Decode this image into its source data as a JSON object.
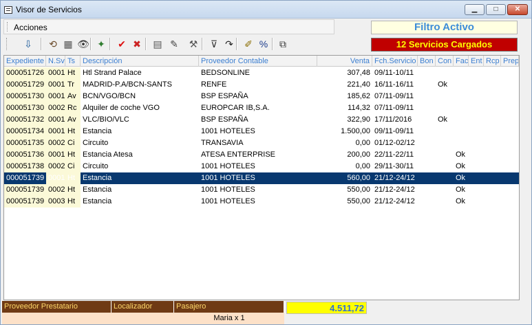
{
  "window": {
    "title": "Visor de Servicios"
  },
  "menu": {
    "items": [
      {
        "label": "Acciones"
      }
    ]
  },
  "status": {
    "filter": "Filtro Activo",
    "count": "12 Servicios Cargados"
  },
  "toolbar": {
    "buttons": [
      {
        "icon": "import-icon",
        "glyph": "⇩"
      },
      {
        "icon": "refresh-icon",
        "glyph": "⟲"
      },
      {
        "icon": "select-all-icon",
        "glyph": "▦"
      },
      {
        "icon": "view-eye-icon",
        "glyph": "👁"
      },
      {
        "icon": "rs-validate-icon",
        "glyph": "✦"
      },
      {
        "icon": "check-icon",
        "glyph": "✔"
      },
      {
        "icon": "delete-x-icon",
        "glyph": "✖"
      },
      {
        "icon": "calculator-icon",
        "glyph": "▤"
      },
      {
        "icon": "edit-dropdown-icon",
        "glyph": "✎"
      },
      {
        "icon": "tools-icon",
        "glyph": "⚒"
      },
      {
        "icon": "filter-icon",
        "glyph": "⊽"
      },
      {
        "icon": "forward-arrow-icon",
        "glyph": "↷"
      },
      {
        "icon": "pencil-note-icon",
        "glyph": "✐"
      },
      {
        "icon": "percent-icon",
        "glyph": "%"
      },
      {
        "icon": "copy-icon",
        "glyph": "⧉"
      }
    ]
  },
  "grid": {
    "columns": [
      "Expediente",
      "N.Sv",
      "Ts",
      "Descripción",
      "Proveedor Contable",
      "Venta",
      "Fch.Servicio",
      "Bon",
      "Con",
      "Fac",
      "Ent",
      "Rcp",
      "Prep"
    ],
    "rows": [
      [
        "000051726",
        "0001",
        "Ht",
        "Htl Strand Palace",
        "BEDSONLINE",
        "307,48",
        "09/11-10/11",
        "",
        "",
        "",
        "",
        "",
        ""
      ],
      [
        "000051729",
        "0001",
        "Tr",
        "MADRID-P.A/BCN-SANTS",
        "RENFE",
        "221,40",
        "16/11-16/11",
        "",
        "Ok",
        "",
        "",
        "",
        ""
      ],
      [
        "000051730",
        "0001",
        "Av",
        "BCN/VGO/BCN",
        "BSP ESPAÑA",
        "185,62",
        "07/11-09/11",
        "",
        "",
        "",
        "",
        "",
        ""
      ],
      [
        "000051730",
        "0002",
        "Rc",
        "Alquiler de coche VGO",
        "EUROPCAR IB,S.A.",
        "114,32",
        "07/11-09/11",
        "",
        "",
        "",
        "",
        "",
        ""
      ],
      [
        "000051732",
        "0001",
        "Av",
        "VLC/BIO/VLC",
        "BSP ESPAÑA",
        "322,90",
        "17/11/2016",
        "",
        "Ok",
        "",
        "",
        "",
        ""
      ],
      [
        "000051734",
        "0001",
        "Ht",
        "Estancia",
        "1001 HOTELES",
        "1.500,00",
        "09/11-09/11",
        "",
        "",
        "",
        "",
        "",
        ""
      ],
      [
        "000051735",
        "0002",
        "Ci",
        "Circuito",
        "TRANSAVIA",
        "0,00",
        "01/12-02/12",
        "",
        "",
        "",
        "",
        "",
        ""
      ],
      [
        "000051736",
        "0001",
        "Ht",
        "Estancia Atesa",
        "ATESA ENTERPRISE",
        "200,00",
        "22/11-22/11",
        "",
        "",
        "Ok",
        "",
        "",
        ""
      ],
      [
        "000051738",
        "0002",
        "Ci",
        "Circuito",
        "1001 HOTELES",
        "0,00",
        "29/11-30/11",
        "",
        "",
        "Ok",
        "",
        "",
        ""
      ],
      [
        "000051739",
        "0001",
        "Ht",
        "Estancia",
        "1001 HOTELES",
        "560,00",
        "21/12-24/12",
        "",
        "",
        "Ok",
        "",
        "",
        ""
      ],
      [
        "000051739",
        "0002",
        "Ht",
        "Estancia",
        "1001 HOTELES",
        "550,00",
        "21/12-24/12",
        "",
        "",
        "Ok",
        "",
        "",
        ""
      ],
      [
        "000051739",
        "0003",
        "Ht",
        "Estancia",
        "1001 HOTELES",
        "550,00",
        "21/12-24/12",
        "",
        "",
        "Ok",
        "",
        "",
        ""
      ]
    ],
    "selected_row": 9
  },
  "footer": {
    "headers": [
      "Proveedor Prestatario",
      "Localizador",
      "Pasajero"
    ],
    "values": [
      "",
      "",
      "Maria x 1"
    ],
    "total": "4.511,72"
  },
  "colors": {
    "selection": "#08386f",
    "header_text": "#3c7fd1",
    "filter_text": "#3c8cd8",
    "count_bg": "#c00000",
    "count_text": "#ffff00",
    "footer_bg": "#6f3a14",
    "total_bg": "#ffff00"
  }
}
